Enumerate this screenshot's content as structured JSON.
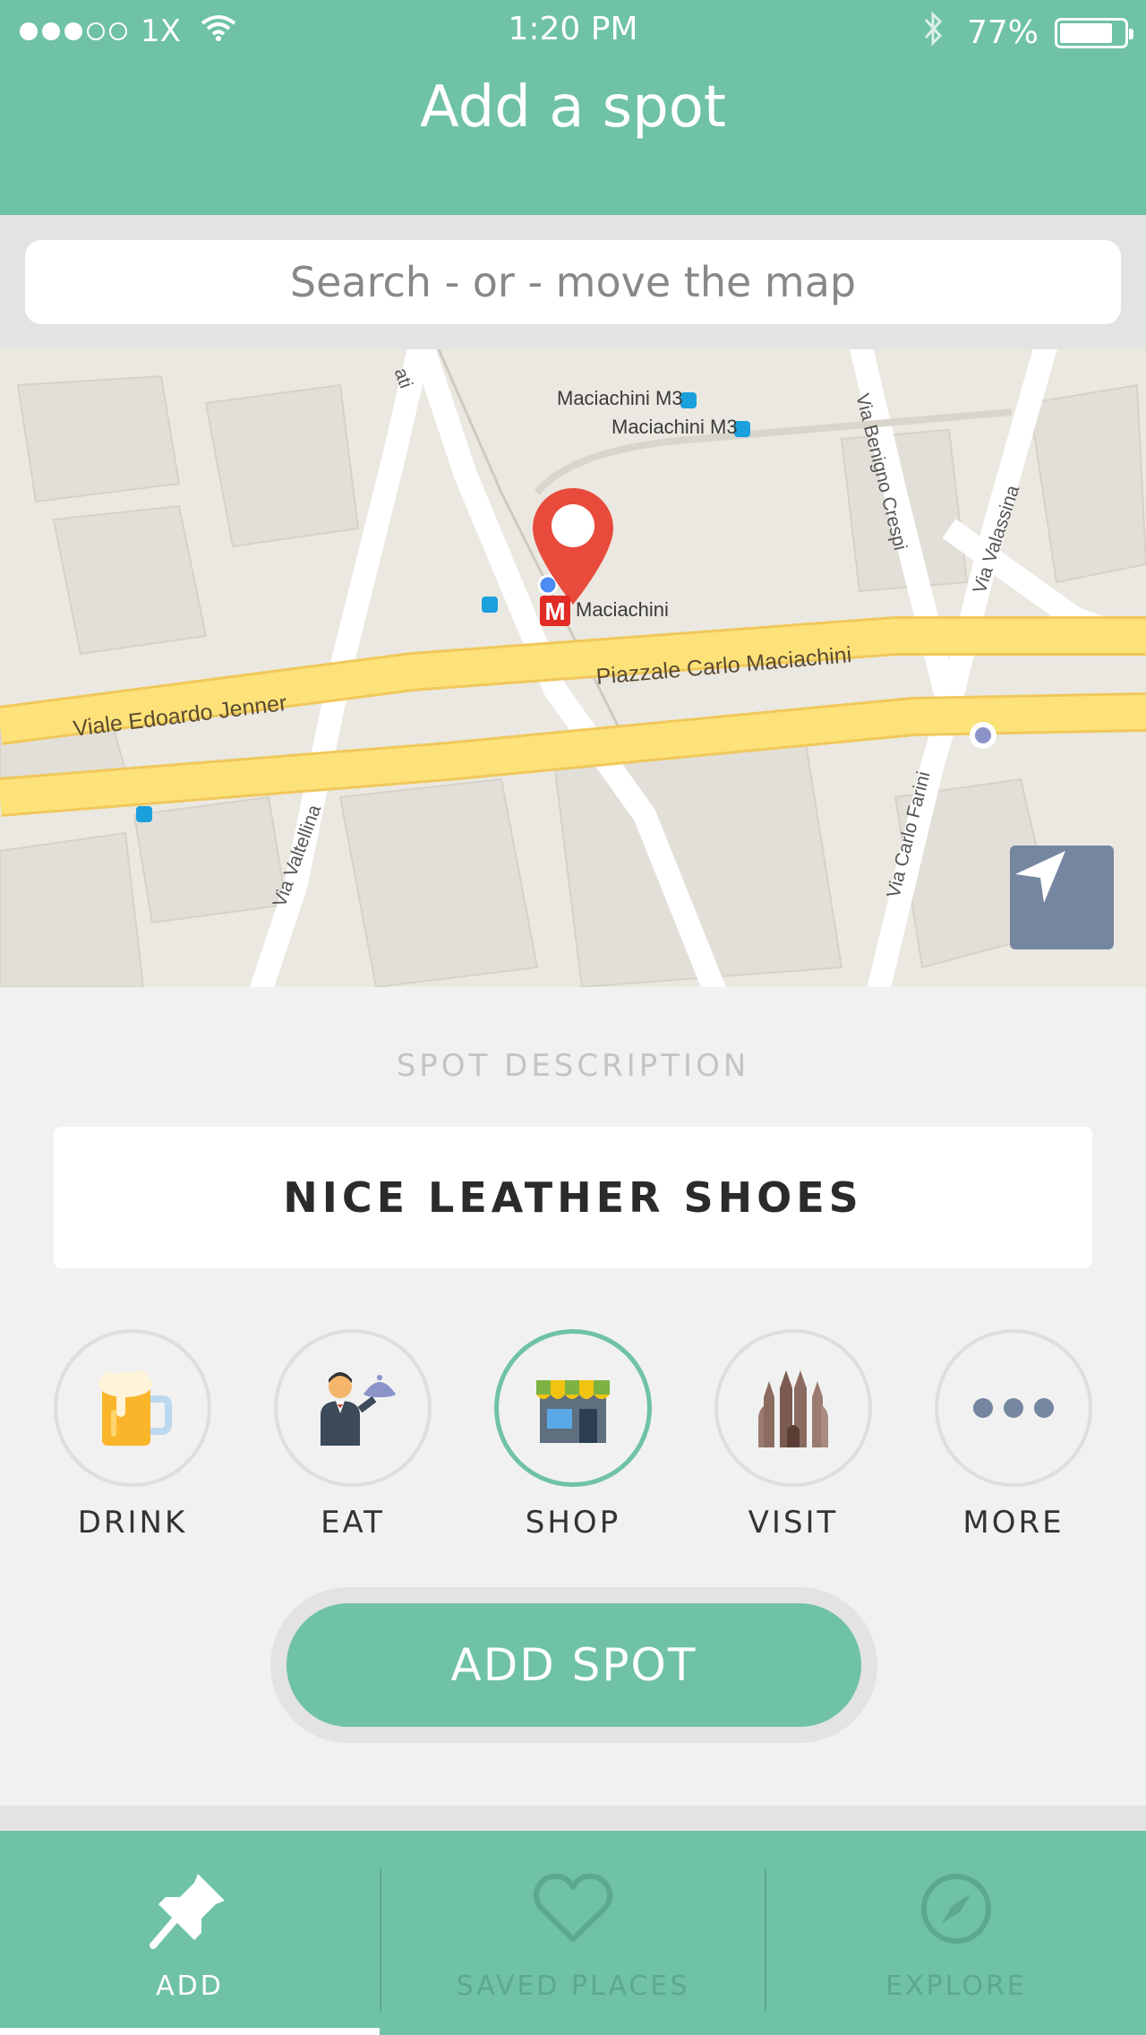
{
  "status_bar": {
    "carrier": "1X",
    "time": "1:20 PM",
    "battery": "77%",
    "battery_level": 0.77
  },
  "header": {
    "title": "Add a spot"
  },
  "search": {
    "placeholder": "Search - or - move the map"
  },
  "map": {
    "labels": {
      "station_1": "Maciachini M3",
      "station_2": "Maciachini M3",
      "station_3": "Maciachini",
      "road_1": "Viale Edoardo Jenner",
      "road_2": "Piazzale Carlo Maciachini",
      "street_1": "Via Valtellina",
      "street_2": "Via Benigno Crespi",
      "street_3": "Via Valassina",
      "street_4": "Via Carlo Farini",
      "street_5": "ati"
    },
    "colors": {
      "road": "#fde27a",
      "water": "#ebe8e1",
      "pin": "#e84b3c"
    }
  },
  "description": {
    "section_label": "SPOT DESCRIPTION",
    "value": "NICE LEATHER SHOES"
  },
  "categories": [
    {
      "label": "DRINK",
      "icon": "beer-mug-icon"
    },
    {
      "label": "EAT",
      "icon": "waiter-icon"
    },
    {
      "label": "SHOP",
      "icon": "storefront-icon",
      "selected": true
    },
    {
      "label": "VISIT",
      "icon": "cathedral-icon"
    },
    {
      "label": "MORE",
      "icon": "more-dots-icon"
    }
  ],
  "add_button": {
    "label": "ADD SPOT"
  },
  "tabs": [
    {
      "label": "ADD",
      "icon": "pushpin-icon",
      "active": true
    },
    {
      "label": "SAVED PLACES",
      "icon": "heart-icon"
    },
    {
      "label": "EXPLORE",
      "icon": "compass-icon"
    }
  ],
  "colors": {
    "accent": "#6fc2a5",
    "background": "#f1f1f1"
  }
}
